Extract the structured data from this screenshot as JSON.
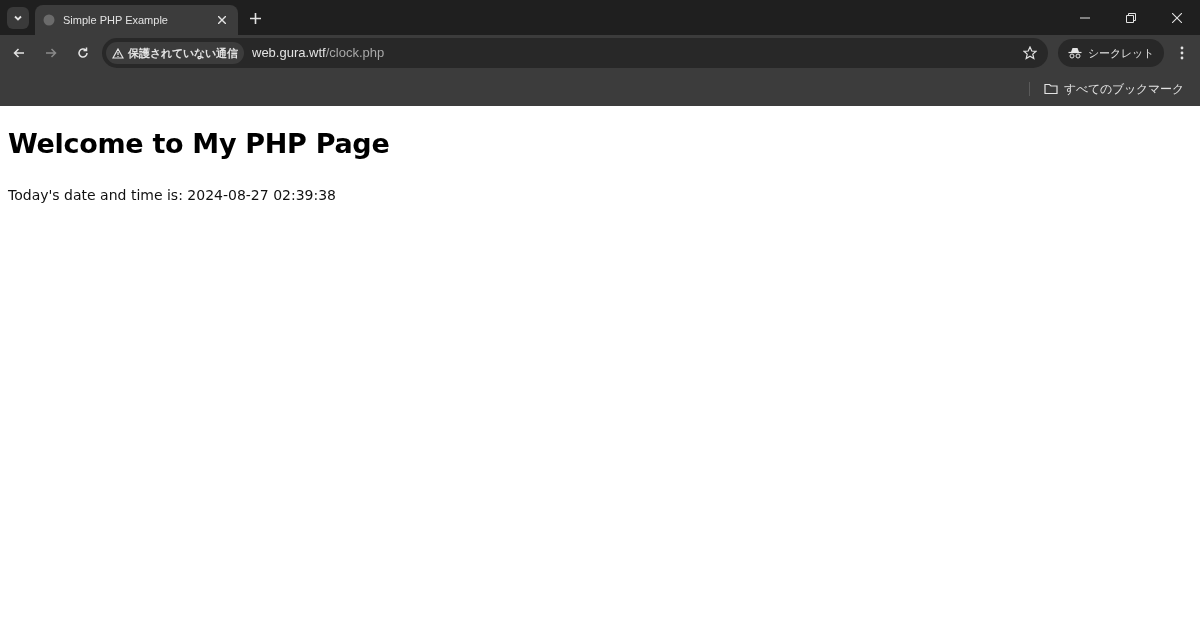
{
  "tabs": [
    {
      "title": "Simple PHP Example",
      "selected": true
    }
  ],
  "address_bar": {
    "security_label": "保護されていない通信",
    "url_host": "web.gura.wtf",
    "url_path": "/clock.php"
  },
  "profile_chip": {
    "label": "シークレット"
  },
  "bookmarks_bar": {
    "all_bookmarks": "すべてのブックマーク"
  },
  "page": {
    "heading": "Welcome to My PHP Page",
    "paragraph": "Today's date and time is: 2024-08-27 02:39:38"
  }
}
